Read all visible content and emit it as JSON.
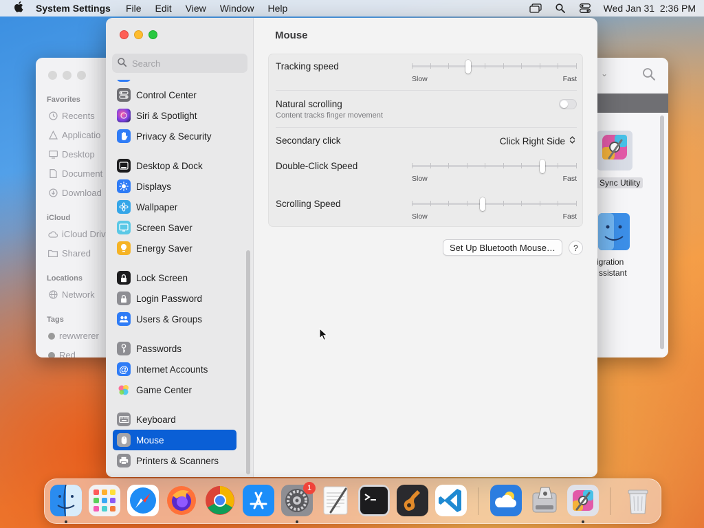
{
  "menubar": {
    "app_name": "System Settings",
    "menus": [
      "File",
      "Edit",
      "View",
      "Window",
      "Help"
    ],
    "datetime": "Wed Jan 31  2:36 PM"
  },
  "finder": {
    "sections": {
      "favorites": "Favorites",
      "icloud": "iCloud",
      "locations": "Locations",
      "tags": "Tags"
    },
    "items": {
      "recents": "Recents",
      "applications": "Applicatio",
      "desktop": "Desktop",
      "documents": "Document",
      "downloads": "Download",
      "icloud_drive": "iCloud Driv",
      "shared": "Shared",
      "network": "Network",
      "tag1": "rewwrerer",
      "tag2": "Red"
    },
    "files": {
      "sync_utility": "Sync Utility",
      "migration_line1": "igration",
      "migration_line2": "ssistant"
    }
  },
  "settings": {
    "search_placeholder": "Search",
    "sidebar": [
      {
        "label": "Control Center",
        "icon": "control-center-icon",
        "color": "#6e6e73"
      },
      {
        "label": "Siri & Spotlight",
        "icon": "siri-icon",
        "color": "#b04bd8"
      },
      {
        "label": "Privacy & Security",
        "icon": "hand-icon",
        "color": "#2f7cf6"
      },
      {
        "label": "Desktop & Dock",
        "icon": "dock-icon",
        "color": "#1c1c1e"
      },
      {
        "label": "Displays",
        "icon": "sun-icon",
        "color": "#2f7cf6"
      },
      {
        "label": "Wallpaper",
        "icon": "flower-icon",
        "color": "#35a6e8"
      },
      {
        "label": "Screen Saver",
        "icon": "screen-saver-icon",
        "color": "#5ac8e6"
      },
      {
        "label": "Energy Saver",
        "icon": "bulb-icon",
        "color": "#f5b325"
      },
      {
        "label": "Lock Screen",
        "icon": "lock-icon",
        "color": "#1c1c1e"
      },
      {
        "label": "Login Password",
        "icon": "padlock-icon",
        "color": "#8e8e93"
      },
      {
        "label": "Users & Groups",
        "icon": "users-icon",
        "color": "#2f7cf6"
      },
      {
        "label": "Passwords",
        "icon": "key-icon",
        "color": "#8e8e93"
      },
      {
        "label": "Internet Accounts",
        "icon": "at-icon",
        "color": "#2f7cf6"
      },
      {
        "label": "Game Center",
        "icon": "game-center-icon",
        "color": "#f2f2f2"
      },
      {
        "label": "Keyboard",
        "icon": "keyboard-icon",
        "color": "#8e8e93"
      },
      {
        "label": "Mouse",
        "icon": "mouse-icon",
        "color": "#8e8e93"
      },
      {
        "label": "Printers & Scanners",
        "icon": "printer-icon",
        "color": "#8e8e93"
      }
    ],
    "title": "Mouse",
    "tracking_speed": {
      "label": "Tracking speed",
      "value": 0.34,
      "slow": "Slow",
      "fast": "Fast"
    },
    "natural_scrolling": {
      "label": "Natural scrolling",
      "sub": "Content tracks finger movement",
      "enabled": false
    },
    "secondary_click": {
      "label": "Secondary click",
      "value": "Click Right Side"
    },
    "double_click_speed": {
      "label": "Double-Click Speed",
      "value": 0.79,
      "slow": "Slow",
      "fast": "Fast"
    },
    "scrolling_speed": {
      "label": "Scrolling Speed",
      "value": 0.43,
      "slow": "Slow",
      "fast": "Fast"
    },
    "bluetooth_button": "Set Up Bluetooth Mouse…",
    "help_button": "?"
  },
  "dock": {
    "badge_count": "1",
    "apps": [
      "finder-icon",
      "launchpad-icon",
      "safari-icon",
      "firefox-icon",
      "chrome-icon",
      "app-store-icon",
      "system-settings-icon",
      "textedit-icon",
      "terminal-icon",
      "garageband-icon",
      "vscode-icon",
      "weather-icon",
      "disk-utility-icon",
      "sync-utility-icon",
      "trash-icon"
    ]
  }
}
